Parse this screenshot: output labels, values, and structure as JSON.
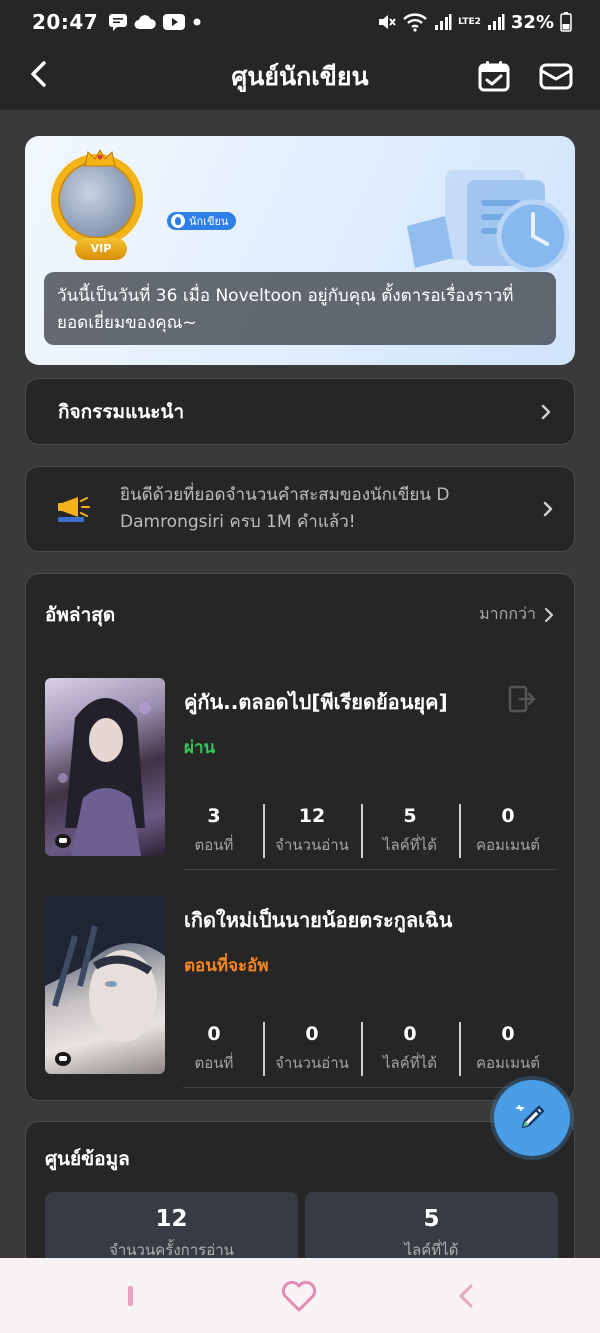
{
  "status_bar": {
    "time": "20:47",
    "battery": "32%",
    "network": "LTE2"
  },
  "header": {
    "title": "ศูนย์นักเขียน"
  },
  "profile": {
    "vip_label": "VIP",
    "writer_badge": "นักเขียน",
    "welcome": "วันนี้เป็นวันที่ 36 เมื่อ Noveltoon อยู่กับคุณ ตั้งตารอเรื่องราวที่ยอดเยี่ยมของคุณ~"
  },
  "activity": {
    "title": "กิจกรรมแนะนำ"
  },
  "announcement": {
    "text": "ยินดีด้วยที่ยอดจำนวนคำสะสมของนักเขียน D Damrongsiri ครบ 1M คำแล้ว!"
  },
  "updates": {
    "title": "อัพล่าสุด",
    "more": "มากกว่า",
    "works": [
      {
        "title": "คู่กัน..ตลอดไป[พีเรียดย้อนยุค]",
        "status": "ผ่าน",
        "stats": [
          {
            "value": "3",
            "label": "ตอนที่"
          },
          {
            "value": "12",
            "label": "จำนวนอ่าน"
          },
          {
            "value": "5",
            "label": "ไลค์ที่ได้"
          },
          {
            "value": "0",
            "label": "คอมเมนต์"
          }
        ]
      },
      {
        "title": "เกิดใหม่เป็นนายน้อยตระกูลเฉิน",
        "status": "ตอนที่จะอัพ",
        "stats": [
          {
            "value": "0",
            "label": "ตอนที่"
          },
          {
            "value": "0",
            "label": "จำนวนอ่าน"
          },
          {
            "value": "0",
            "label": "ไลค์ที่ได้"
          },
          {
            "value": "0",
            "label": "คอมเมนต์"
          }
        ]
      }
    ]
  },
  "data_center": {
    "title": "ศูนย์ข้อมูล",
    "tiles": [
      {
        "value": "12",
        "label": "จำนวนครั้งการอ่าน"
      },
      {
        "value": "5",
        "label": "ไลค์ที่ได้"
      }
    ]
  },
  "colors": {
    "accent_blue": "#4a9ee8",
    "status_pass": "#34c65e",
    "status_pending": "#f4861f",
    "vip_gold": "#f2b416"
  }
}
